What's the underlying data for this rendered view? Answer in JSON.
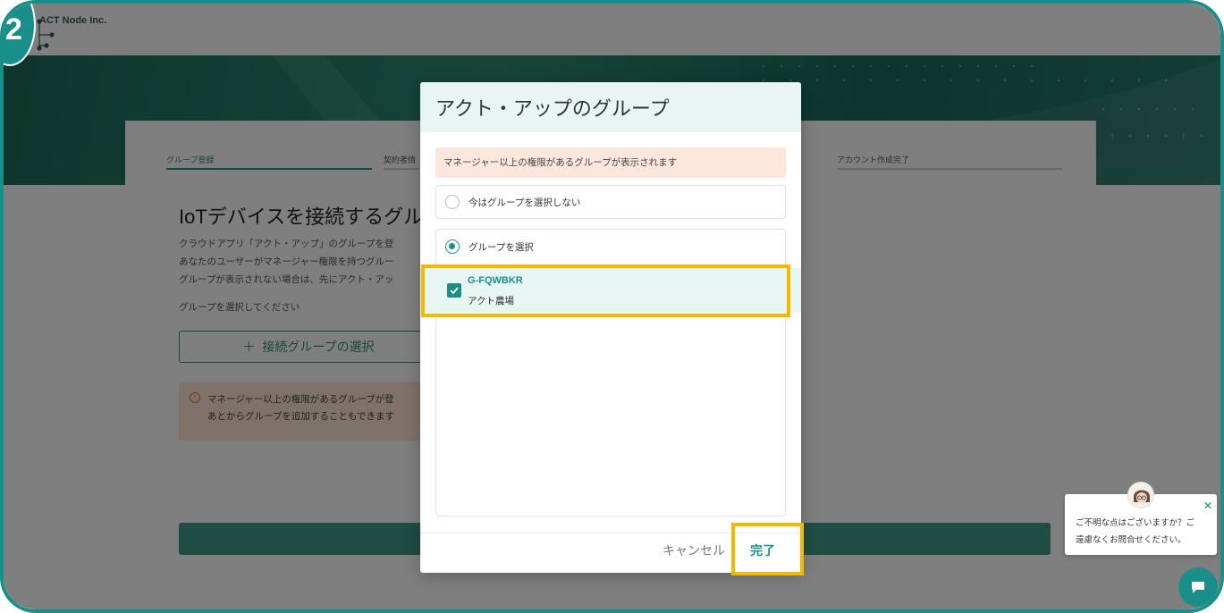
{
  "brand": {
    "logo_text": "ACT Node Inc."
  },
  "step_badge": {
    "number": "2"
  },
  "stepper": {
    "steps": [
      "グループ登録",
      "契約者情",
      "アカウント作成完了"
    ]
  },
  "page": {
    "title": "IoTデバイスを接続するグル",
    "description": [
      "クラウドアプリ「アクト・アップ」のグループを登",
      "あなたのユーザーがマネージャー権限を持つグルー",
      "グループが表示されない場合は、先にアクト・アッ"
    ],
    "prompt": "グループを選択してください",
    "connect_button": "接続グループの選択",
    "warning": [
      "マネージャー以上の権限があるグループが登",
      "あとからグループを追加することもできます"
    ]
  },
  "modal": {
    "title": "アクト・アップのグループ",
    "notice": "マネージャー以上の権限があるグループが表示されます",
    "option_none": "今はグループを選択しない",
    "option_select": "グループを選択",
    "selected_option": "option_select",
    "groups": [
      {
        "code": "G-FQWBKR",
        "name": "アクト農場",
        "checked": true
      }
    ],
    "cancel_label": "キャンセル",
    "done_label": "完了"
  },
  "chat": {
    "lines": [
      "ご不明な点はございますか？ご",
      "遠慮なくお問合せください。"
    ]
  },
  "colors": {
    "accent": "#1a8f8a",
    "highlight": "#f5b800",
    "notice_bg": "#fde6dc"
  }
}
